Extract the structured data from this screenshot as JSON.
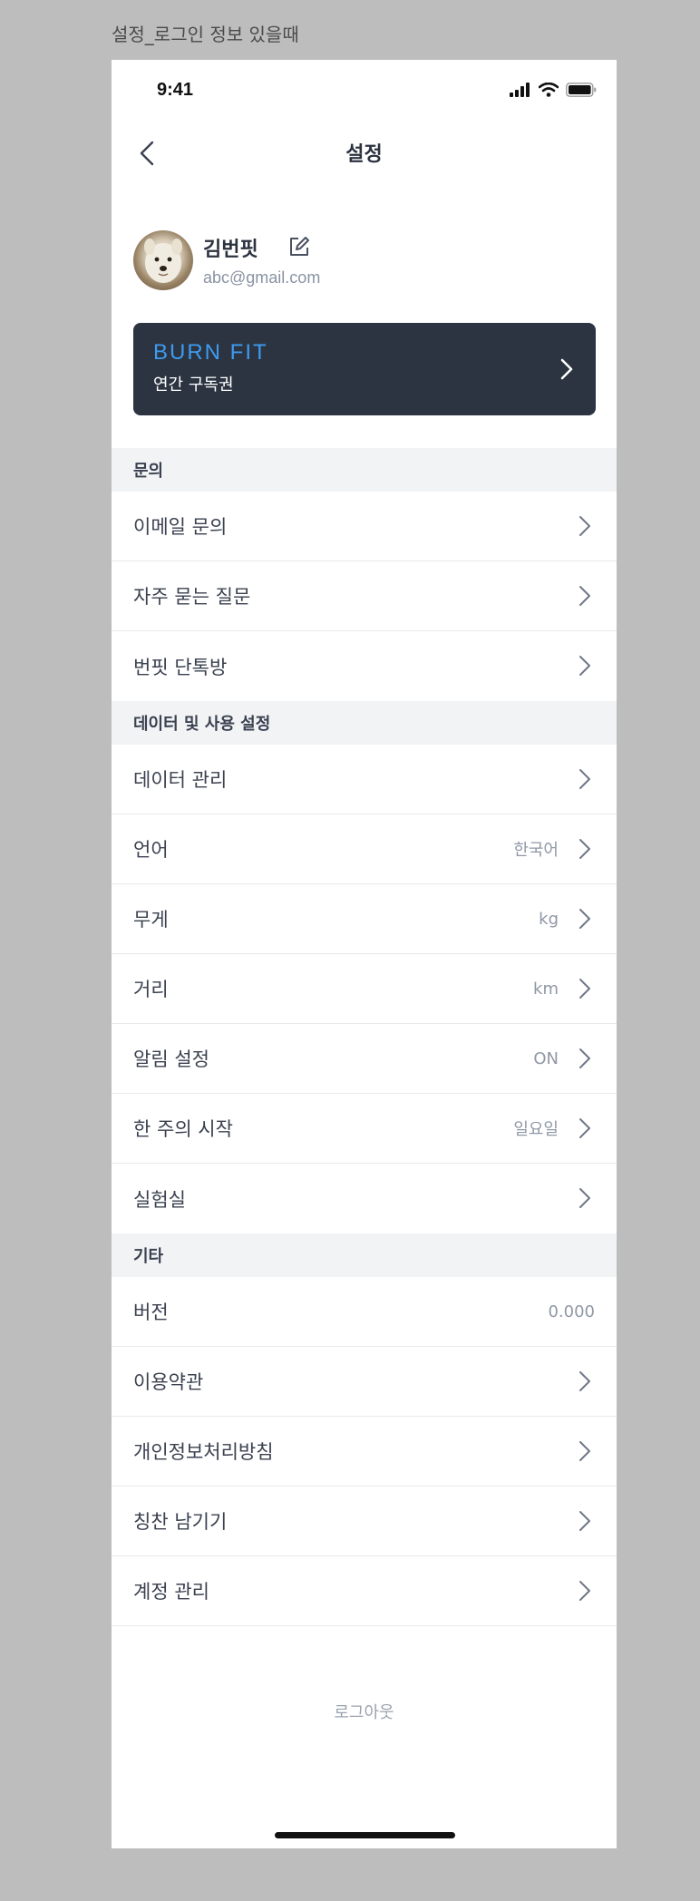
{
  "frame_caption": "설정_로그인 정보 있을때",
  "status": {
    "time": "9:41"
  },
  "nav": {
    "title": "설정"
  },
  "profile": {
    "name": "김번핏",
    "email": "abc@gmail.com"
  },
  "subscription": {
    "brand": "BURN FIT",
    "label": "연간 구독권"
  },
  "sections": [
    {
      "header": "문의",
      "rows": [
        {
          "label": "이메일 문의",
          "value": ""
        },
        {
          "label": "자주 묻는 질문",
          "value": ""
        },
        {
          "label": "번핏 단톡방",
          "value": ""
        }
      ]
    },
    {
      "header": "데이터 및 사용 설정",
      "rows": [
        {
          "label": "데이터 관리",
          "value": ""
        },
        {
          "label": "언어",
          "value": "한국어"
        },
        {
          "label": "무게",
          "value": "kg"
        },
        {
          "label": "거리",
          "value": "km"
        },
        {
          "label": "알림 설정",
          "value": "ON"
        },
        {
          "label": "한 주의 시작",
          "value": "일요일"
        },
        {
          "label": "실험실",
          "value": ""
        }
      ]
    },
    {
      "header": "기타",
      "rows": [
        {
          "label": "버전",
          "value": "0.000"
        },
        {
          "label": "이용약관",
          "value": ""
        },
        {
          "label": "개인정보처리방침",
          "value": ""
        },
        {
          "label": "칭찬 남기기",
          "value": ""
        },
        {
          "label": "계정 관리",
          "value": ""
        }
      ]
    }
  ],
  "logout_label": "로그아웃",
  "colors": {
    "card_bg": "#2b3440",
    "brand_blue": "#3e9bf0",
    "section_bg": "#f2f3f5"
  }
}
